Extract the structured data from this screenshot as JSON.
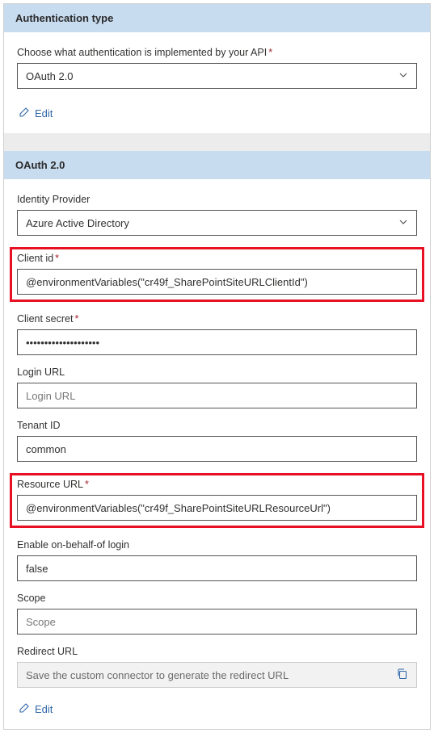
{
  "auth_section": {
    "header": "Authentication type",
    "choose_label": "Choose what authentication is implemented by your API",
    "selected": "OAuth 2.0",
    "edit_label": "Edit"
  },
  "oauth_section": {
    "header": "OAuth 2.0",
    "identity_provider": {
      "label": "Identity Provider",
      "value": "Azure Active Directory"
    },
    "client_id": {
      "label": "Client id",
      "value": "@environmentVariables(\"cr49f_SharePointSiteURLClientId\")"
    },
    "client_secret": {
      "label": "Client secret",
      "value": "••••••••••••••••••••"
    },
    "login_url": {
      "label": "Login URL",
      "placeholder": "Login URL",
      "value": ""
    },
    "tenant_id": {
      "label": "Tenant ID",
      "value": "common"
    },
    "resource_url": {
      "label": "Resource URL",
      "value": "@environmentVariables(\"cr49f_SharePointSiteURLResourceUrl\")"
    },
    "enable_obo": {
      "label": "Enable on-behalf-of login",
      "value": "false"
    },
    "scope": {
      "label": "Scope",
      "placeholder": "Scope",
      "value": ""
    },
    "redirect_url": {
      "label": "Redirect URL",
      "placeholder": "Save the custom connector to generate the redirect URL"
    },
    "edit_label": "Edit"
  },
  "icons": {
    "edit": "edit-icon",
    "chevron": "chevron-down-icon",
    "copy": "copy-icon"
  }
}
